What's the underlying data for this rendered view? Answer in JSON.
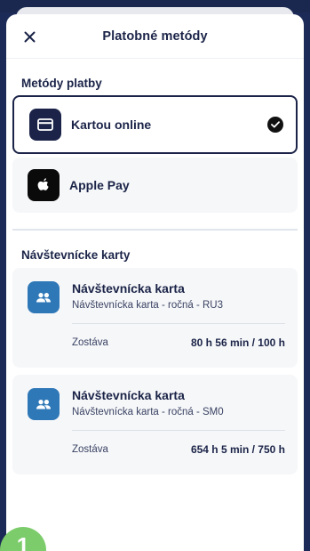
{
  "header": {
    "title": "Platobné metódy"
  },
  "methods_section": {
    "title": "Metódy platby",
    "items": [
      {
        "label": "Kartou online",
        "selected": true,
        "icon": "credit-card-icon"
      },
      {
        "label": "Apple Pay",
        "selected": false,
        "icon": "apple-icon"
      }
    ]
  },
  "visitor_section": {
    "title": "Návštevnícke karty",
    "cards": [
      {
        "name": "Návštevnícka karta",
        "subtitle": "Návštevnícka karta - ročná - RU3",
        "remaining_label": "Zostáva",
        "remaining_value": "80 h 56 min / 100 h"
      },
      {
        "name": "Návštevnícka karta",
        "subtitle": "Návštevnícka karta - ročná - SM0",
        "remaining_label": "Zostáva",
        "remaining_value": "654 h 5 min / 750 h"
      }
    ]
  },
  "badge": {
    "text": "1"
  },
  "colors": {
    "navy": "#1b2448",
    "accent_blue": "#2f78b8",
    "badge_green": "#7dcc6b",
    "backdrop": "#1c2a57"
  }
}
